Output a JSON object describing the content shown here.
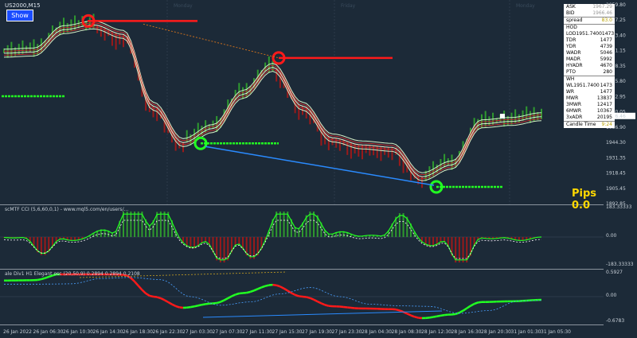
{
  "header": {
    "symbol": "US2000,M15",
    "show_button": "Show"
  },
  "session_labels": [
    "Monday",
    "Friday",
    "Monday"
  ],
  "price_panel": {
    "y_ticks": [
      "2059.80",
      "2047.25",
      "2033.40",
      "2021.15",
      "2008.35",
      "1995.80",
      "1982.95",
      "1970.05",
      "1956.90",
      "1944.30",
      "1931.35",
      "1918.45",
      "1905.45",
      "1892.85"
    ],
    "current_price": "1966.46",
    "pips_label": "Pips 0.0"
  },
  "info_panel": {
    "ask_label": "ASK",
    "ask_value": "1967.29",
    "bid_label": "BID",
    "bid_value": "1966.46",
    "spread_label": "spread",
    "spread_value": "83.0",
    "hod_label": "HOD",
    "rows_hod": [
      {
        "k": "LOD1951.7400 :",
        "v": "1473"
      },
      {
        "k": "TDR",
        "v": "1477"
      },
      {
        "k": "YDR",
        "v": "4739"
      },
      {
        "k": "WADR",
        "v": "5046"
      },
      {
        "k": "MADR",
        "v": "5992"
      },
      {
        "k": "HYADR",
        "v": "4670"
      },
      {
        "k": "PTO",
        "v": "280"
      }
    ],
    "wh_label": "WH",
    "rows_wh": [
      {
        "k": "WL1951.7400 :",
        "v": "1473"
      },
      {
        "k": "WR",
        "v": "1477"
      },
      {
        "k": "MWR",
        "v": "13837"
      },
      {
        "k": "3MWR",
        "v": "12417"
      },
      {
        "k": "6MWR",
        "v": "10367"
      },
      {
        "k": "3xADR",
        "v": "20195"
      }
    ],
    "candle_time_label": "Candle Time",
    "candle_time_value": "9:24"
  },
  "cci_panel": {
    "title": "scMTF CCI (5,6,60,0,1) - www.mql5.com/en/users/...",
    "y_ticks": [
      "183.33333",
      "0.00",
      "-183.33333"
    ]
  },
  "osc_panel": {
    "title": "ale Div1 H1 Elegant osc (20,50,9) 0.2894 0.2894 0.2108",
    "y_ticks": [
      "0.5927",
      "0.00",
      "-0.6783"
    ]
  },
  "x_axis": {
    "labels": [
      "26 Jan 2022",
      "26 Jan 06:30",
      "26 Jan 10:30",
      "26 Jan 14:30",
      "26 Jan 18:30",
      "26 Jan 22:30",
      "27 Jan 03:30",
      "27 Jan 07:30",
      "27 Jan 11:30",
      "27 Jan 15:30",
      "27 Jan 19:30",
      "27 Jan 23:30",
      "28 Jan 04:30",
      "28 Jan 08:30",
      "28 Jan 12:30",
      "28 Jan 16:30",
      "28 Jan 20:30",
      "31 Jan 01:30",
      "31 Jan 05:30"
    ]
  },
  "chart_data": {
    "type": "line",
    "x": [
      "26 Jan 2022",
      "26 Jan 06:30",
      "26 Jan 10:30",
      "26 Jan 14:30",
      "26 Jan 18:30",
      "26 Jan 22:30",
      "27 Jan 03:30",
      "27 Jan 07:30",
      "27 Jan 11:30",
      "27 Jan 15:30",
      "27 Jan 19:30",
      "27 Jan 23:30",
      "28 Jan 04:30",
      "28 Jan 08:30",
      "28 Jan 12:30",
      "28 Jan 16:30",
      "28 Jan 20:30",
      "31 Jan 01:30",
      "31 Jan 05:30"
    ],
    "series": [
      {
        "values": [
          2020,
          2021,
          2040,
          2044,
          2036,
          1975,
          1944,
          1956,
          1985,
          2008,
          1975,
          1948,
          1942,
          1940,
          1915,
          1925,
          1960,
          1962,
          1966
        ]
      }
    ],
    "ylim": [
      1892.85,
      2059.8
    ],
    "resistance": [
      2042,
      2018
    ],
    "support": [
      1942,
      1905
    ]
  }
}
